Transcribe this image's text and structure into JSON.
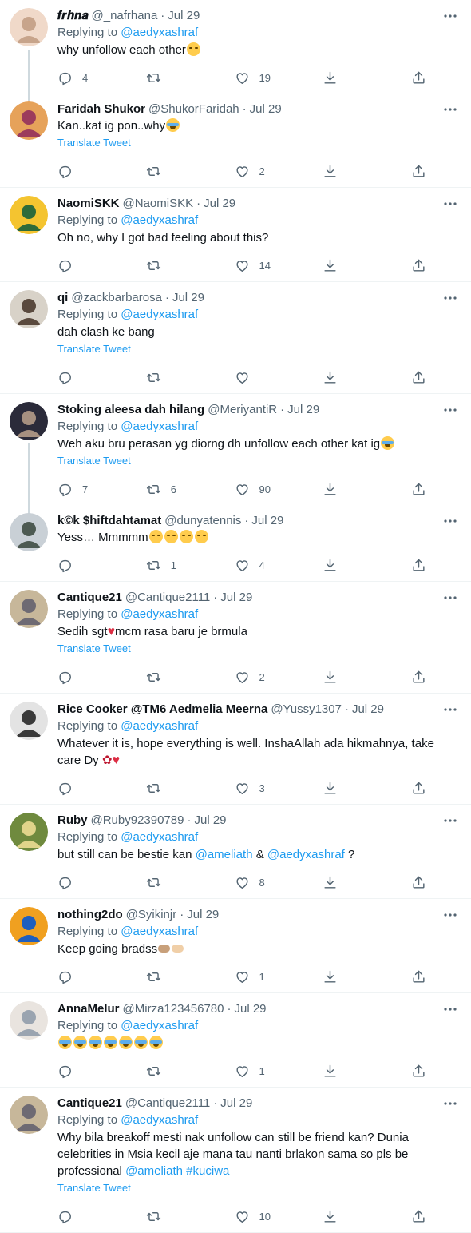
{
  "labels": {
    "replying_to": "Replying to",
    "translate": "Translate Tweet",
    "dot": "·"
  },
  "tweets": [
    {
      "name": "𝒇𝒓𝒉𝒏𝒂",
      "handle": "@_nafrhana",
      "time": "Jul 29",
      "replying": "@aedyxashraf",
      "text": "why unfollow each other",
      "emoji": "face",
      "translate": false,
      "replies": "4",
      "retweets": "",
      "likes": "19",
      "avatar": [
        "#f0d9c9",
        "#c7a48b"
      ],
      "threaded": true
    },
    {
      "name": "Faridah Shukor",
      "handle": "@ShukorFaridah",
      "time": "Jul 29",
      "replying": "",
      "text": "Kan..kat ig pon..why",
      "emoji": "cry",
      "translate": true,
      "replies": "",
      "retweets": "",
      "likes": "2",
      "avatar": [
        "#e6a25a",
        "#9c3b5c"
      ],
      "threaded": false
    },
    {
      "name": "NaomiSKK",
      "handle": "@NaomiSKK",
      "time": "Jul 29",
      "replying": "@aedyxashraf",
      "text": "Oh no, why I got bad feeling about this?",
      "emoji": "",
      "translate": false,
      "replies": "",
      "retweets": "",
      "likes": "14",
      "avatar": [
        "#f4c430",
        "#2e6b3a"
      ],
      "threaded": false
    },
    {
      "name": "qi",
      "handle": "@zackbarbarosa",
      "time": "Jul 29",
      "replying": "@aedyxashraf",
      "text": "dah clash ke bang",
      "emoji": "",
      "translate": true,
      "replies": "",
      "retweets": "",
      "likes": "",
      "avatar": [
        "#d8d2c8",
        "#5a4a3e"
      ],
      "threaded": false
    },
    {
      "name": "Stoking aleesa dah hilang",
      "handle": "@MeriyantiR",
      "time": "Jul 29",
      "replying": "@aedyxashraf",
      "text": "Weh aku bru perasan yg diorng dh unfollow each other kat ig",
      "emoji": "cry",
      "translate": true,
      "replies": "7",
      "retweets": "6",
      "likes": "90",
      "avatar": [
        "#2b2b3a",
        "#a69080"
      ],
      "threaded": true
    },
    {
      "name": "k©k $hiftdahtamat",
      "handle": "@dunyatennis",
      "time": "Jul 29",
      "replying": "",
      "text": "Yess… Mmmmm",
      "emoji": "face4",
      "translate": false,
      "replies": "",
      "retweets": "1",
      "likes": "4",
      "avatar": [
        "#c9d0d6",
        "#4d5a52"
      ],
      "threaded": false
    },
    {
      "name": "Cantique21",
      "handle": "@Cantique2111",
      "time": "Jul 29",
      "replying": "@aedyxashraf",
      "text": "Sedih sgt",
      "text2": "mcm rasa baru je brmula",
      "emoji": "broken",
      "translate": true,
      "replies": "",
      "retweets": "",
      "likes": "2",
      "avatar": [
        "#c7b79a",
        "#6e6a73"
      ],
      "threaded": false
    },
    {
      "name": "Rice Cooker @TM6 Aedmelia Meerna",
      "handle": "@Yussy1307",
      "time": "Jul 29",
      "replying": "@aedyxashraf",
      "text": "Whatever it is, hope everything is well. InshaAllah ada hikmahnya, take care Dy",
      "emoji": "rose-heart",
      "translate": false,
      "replies": "",
      "retweets": "",
      "likes": "3",
      "avatar": [
        "#e3e3e3",
        "#3a3a3a"
      ],
      "threaded": false
    },
    {
      "name": "Ruby",
      "handle": "@Ruby92390789",
      "time": "Jul 29",
      "replying": "@aedyxashraf",
      "text": "but still can be bestie kan",
      "mention1": "@ameliath",
      "amp": "&",
      "mention2": "@aedyxashraf",
      "tail": "?",
      "emoji": "",
      "translate": false,
      "replies": "",
      "retweets": "",
      "likes": "8",
      "avatar": [
        "#6f8a3e",
        "#e0d48a"
      ],
      "threaded": false
    },
    {
      "name": "nothing2do",
      "handle": "@Syikinjr",
      "time": "Jul 29",
      "replying": "@aedyxashraf",
      "text": "Keep going bradss",
      "emoji": "hands",
      "translate": false,
      "replies": "",
      "retweets": "",
      "likes": "1",
      "avatar": [
        "#f0a020",
        "#1f5fbf"
      ],
      "threaded": false
    },
    {
      "name": "AnnaMelur",
      "handle": "@Mirza123456780",
      "time": "Jul 29",
      "replying": "@aedyxashraf",
      "text": "",
      "emoji": "cry7",
      "translate": false,
      "replies": "",
      "retweets": "",
      "likes": "1",
      "avatar": [
        "#e9e4df",
        "#9aa4b0"
      ],
      "threaded": false
    },
    {
      "name": "Cantique21",
      "handle": "@Cantique2111",
      "time": "Jul 29",
      "replying": "@aedyxashraf",
      "text": "Why bila breakoff mesti nak unfollow can still be friend kan? Dunia celebrities in Msia kecil aje mana tau nanti brlakon sama so pls be professional",
      "mention1": "@ameliath",
      "hashtag": "#kuciwa",
      "emoji": "",
      "translate": true,
      "replies": "",
      "retweets": "",
      "likes": "10",
      "avatar": [
        "#c7b79a",
        "#6e6a73"
      ],
      "threaded": false
    }
  ]
}
